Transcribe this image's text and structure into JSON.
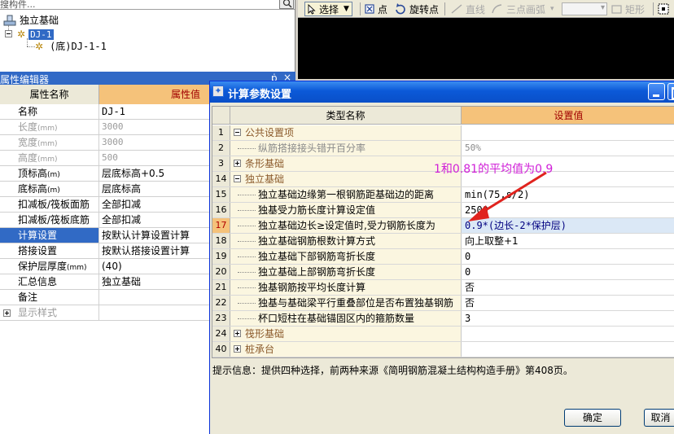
{
  "tree": {
    "search_placeholder": "搜构件...",
    "root_label": "独立基础",
    "child_label": "DJ-1",
    "grandchild_label": "(底)DJ-1-1"
  },
  "toolbar": {
    "select_label": "选择",
    "point_label": "点",
    "rotate_point_label": "旋转点",
    "line_label": "直线",
    "three_point_arc_label": "三点画弧",
    "rectangle_label": "矩形"
  },
  "property_editor": {
    "title": "属性编辑器",
    "header_name": "属性名称",
    "header_value": "属性值",
    "rows": [
      {
        "name": "名称",
        "unit": "",
        "value": "DJ-1"
      },
      {
        "name": "长度",
        "unit": "(mm)",
        "value": "3000"
      },
      {
        "name": "宽度",
        "unit": "(mm)",
        "value": "3000"
      },
      {
        "name": "高度",
        "unit": "(mm)",
        "value": "500"
      },
      {
        "name": "顶标高",
        "unit": "(m)",
        "value": "层底标高+0.5"
      },
      {
        "name": "底标高",
        "unit": "(m)",
        "value": "层底标高"
      },
      {
        "name": "扣减板/筏板面筋",
        "unit": "",
        "value": "全部扣减"
      },
      {
        "name": "扣减板/筏板底筋",
        "unit": "",
        "value": "全部扣减"
      },
      {
        "name": "计算设置",
        "unit": "",
        "value": "按默认计算设置计算"
      },
      {
        "name": "搭接设置",
        "unit": "",
        "value": "按默认搭接设置计算"
      },
      {
        "name": "保护层厚度",
        "unit": "(mm)",
        "value": "(40)"
      },
      {
        "name": "汇总信息",
        "unit": "",
        "value": "独立基础"
      },
      {
        "name": "备注",
        "unit": "",
        "value": ""
      },
      {
        "name": "显示样式",
        "unit": "",
        "value": ""
      }
    ]
  },
  "dialog": {
    "title": "计算参数设置",
    "header_num": "",
    "header_name": "类型名称",
    "header_value": "设置值",
    "rows": [
      {
        "num": "1",
        "name": "公共设置项",
        "value": ""
      },
      {
        "num": "2",
        "name": "纵筋搭接接头错开百分率",
        "value": "50%"
      },
      {
        "num": "3",
        "name": "条形基础",
        "value": ""
      },
      {
        "num": "14",
        "name": "独立基础",
        "value": ""
      },
      {
        "num": "15",
        "name": "独立基础边缘第一根钢筋距基础边的距离",
        "value": "min(75,s/2)"
      },
      {
        "num": "16",
        "name": "独基受力筋长度计算设定值",
        "value": "2500"
      },
      {
        "num": "17",
        "name": "独立基础边长≥设定值时,受力钢筋长度为",
        "value": "0.9*(边长-2*保护层)"
      },
      {
        "num": "18",
        "name": "独立基础钢筋根数计算方式",
        "value": "向上取整+1"
      },
      {
        "num": "19",
        "name": "独立基础下部钢筋弯折长度",
        "value": "0"
      },
      {
        "num": "20",
        "name": "独立基础上部钢筋弯折长度",
        "value": "0"
      },
      {
        "num": "21",
        "name": "独基钢筋按平均长度计算",
        "value": "否"
      },
      {
        "num": "22",
        "name": "独基与基础梁平行重叠部位是否布置独基钢筋",
        "value": "否"
      },
      {
        "num": "23",
        "name": "杯口短柱在基础锚固区内的箍筋数量",
        "value": "3"
      },
      {
        "num": "24",
        "name": "筏形基础",
        "value": ""
      },
      {
        "num": "40",
        "name": "桩承台",
        "value": ""
      }
    ],
    "annotation": "1和0.81的平均值为0.9",
    "hint": "提示信息：提供四种选择，前两种来源《简明钢筋混凝土结构构造手册》第408页。",
    "ok_label": "确定",
    "cancel_label": "取消"
  },
  "colors": {
    "accent_header": "#f5c27a",
    "selection": "#316ac5",
    "annotation": "#d020d8",
    "title_bar": "#0b59d8"
  }
}
